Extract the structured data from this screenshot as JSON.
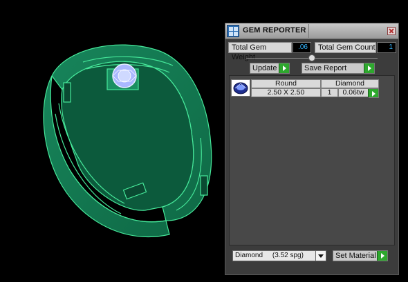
{
  "viewport": {
    "model": "green wireframe ring with round gem"
  },
  "window": {
    "title": "GEM REPORTER",
    "icon": "app-icon",
    "close_icon": "close-icon"
  },
  "summary": {
    "weight_label": "Total Gem Weight",
    "weight_value": ".06",
    "count_label": "Total Gem Count",
    "count_value": "1"
  },
  "actions": {
    "update_label": "Update",
    "save_label": "Save Report"
  },
  "gems": {
    "headers": {
      "shape": "Round",
      "material": "Diamond"
    },
    "rows": [
      {
        "icon": "round-gem-icon",
        "size": "2.50 X 2.50",
        "count": "1",
        "weight": "0.06tw"
      }
    ]
  },
  "footer": {
    "material_selected": "Diamond     (3.52 spg)",
    "set_material_label": "Set Material"
  },
  "colors": {
    "ring": "#1f8f5a",
    "ring_edge": "#3fe38f",
    "gem": "#b8c8ff",
    "panel_bg": "#3c3c3c",
    "accent_value": "#35b7ff",
    "go_button": "#2ea82e"
  }
}
